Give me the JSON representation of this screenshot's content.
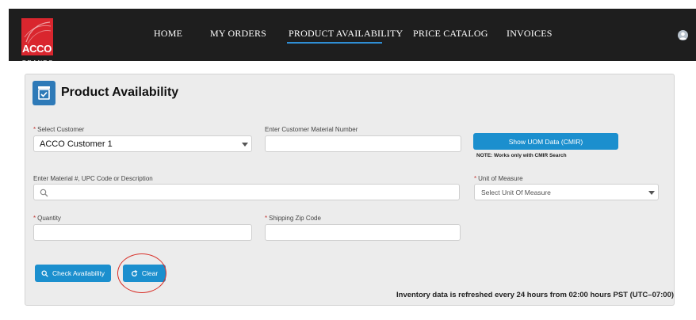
{
  "brand": {
    "name": "ACCO",
    "sub": "BRANDS"
  },
  "nav": {
    "items": [
      {
        "label": "HOME"
      },
      {
        "label": "MY ORDERS"
      },
      {
        "label": "PRODUCT AVAILABILITY"
      },
      {
        "label": "PRICE CATALOG"
      },
      {
        "label": "INVOICES"
      }
    ],
    "active_index": 2
  },
  "page": {
    "title": "Product Availability"
  },
  "form": {
    "customer": {
      "label": "Select Customer",
      "required": true,
      "value": "ACCO Customer 1"
    },
    "customer_material": {
      "label": "Enter Customer Material Number",
      "value": ""
    },
    "show_uom_button": "Show UOM Data (CMIR)",
    "uom_note": "NOTE: Works only with CMIR Search",
    "material_search": {
      "label": "Enter Material #, UPC Code or Description",
      "value": ""
    },
    "unit_of_measure": {
      "label": "Unit of Measure",
      "required": true,
      "placeholder": "Select Unit Of Measure"
    },
    "quantity": {
      "label": "Quantity",
      "required": true,
      "value": ""
    },
    "shipping_zip": {
      "label": "Shipping Zip Code",
      "required": true,
      "value": ""
    },
    "check_button": "Check Availability",
    "clear_button": "Clear"
  },
  "footer_note": "Inventory data is refreshed every 24 hours from 02:00 hours PST (UTC–07:00)",
  "colors": {
    "topbar": "#1e1e1e",
    "brand_red": "#d9262e",
    "accent": "#1b8fce",
    "nav_underline": "#2f8ed4",
    "annotation": "#d8312a"
  }
}
